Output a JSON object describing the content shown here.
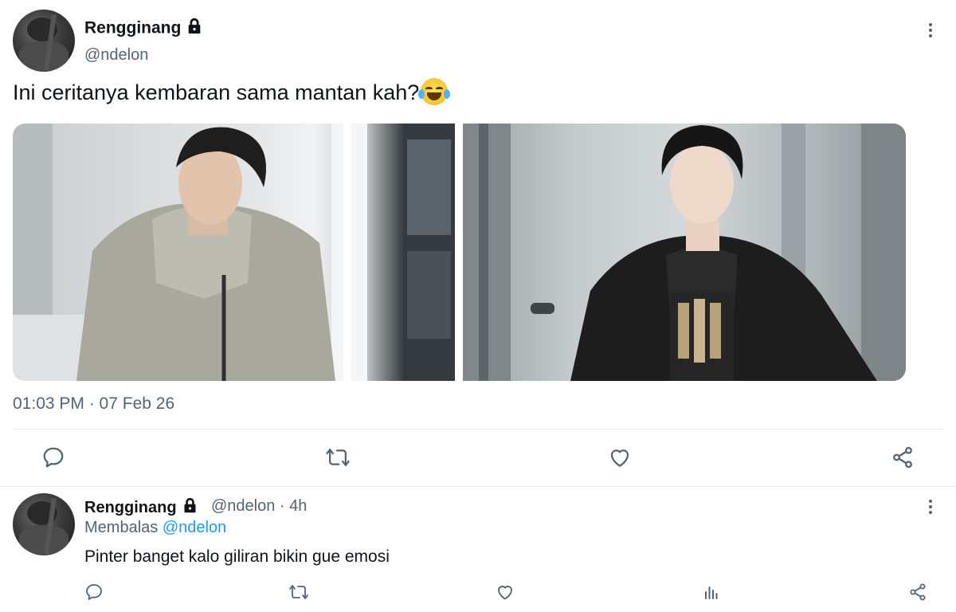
{
  "tweet": {
    "display_name": "Rengginang",
    "handle": "@ndelon",
    "text": "Ini ceritanya kembaran sama mantan kah?",
    "emoji": "face-with-tears-of-joy",
    "timestamp": "01:03 PM · 07 Feb 26",
    "media": [
      {
        "description_icon": "photo-person-hoodie"
      },
      {
        "description_icon": "photo-person-leather-jacket"
      }
    ],
    "actions": [
      "reply-icon",
      "retweet-icon",
      "like-icon",
      "share-icon"
    ]
  },
  "reply": {
    "display_name": "Rengginang",
    "meta": "@ndelon · 4h",
    "replying_prefix": "Membalas",
    "replying_to": "@ndelon",
    "text": "Pinter banget kalo giliran bikin gue emosi",
    "actions": [
      "reply-icon",
      "retweet-icon",
      "like-icon",
      "views-icon",
      "share-icon"
    ]
  },
  "colors": {
    "primary_text": "#0f1419",
    "secondary_text": "#536471",
    "link": "#1d9bf0",
    "divider": "#e6e9eb"
  }
}
